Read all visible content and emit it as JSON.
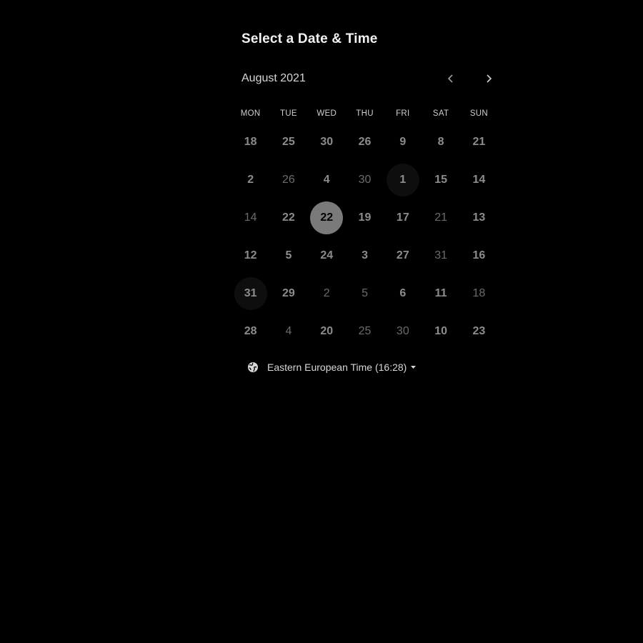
{
  "title": "Select a Date & Time",
  "month_label": "August 2021",
  "weekdays": [
    "MON",
    "TUE",
    "WED",
    "THU",
    "FRI",
    "SAT",
    "SUN"
  ],
  "days": [
    {
      "label": "18",
      "state": "available"
    },
    {
      "label": "25",
      "state": "available"
    },
    {
      "label": "30",
      "state": "available"
    },
    {
      "label": "26",
      "state": "available"
    },
    {
      "label": "9",
      "state": "available"
    },
    {
      "label": "8",
      "state": "available"
    },
    {
      "label": "21",
      "state": "available"
    },
    {
      "label": "2",
      "state": "available"
    },
    {
      "label": "26",
      "state": "unavailable"
    },
    {
      "label": "4",
      "state": "available"
    },
    {
      "label": "30",
      "state": "unavailable"
    },
    {
      "label": "1",
      "state": "available",
      "hint": true
    },
    {
      "label": "15",
      "state": "available"
    },
    {
      "label": "14",
      "state": "available"
    },
    {
      "label": "14",
      "state": "unavailable"
    },
    {
      "label": "22",
      "state": "available"
    },
    {
      "label": "22",
      "state": "selected"
    },
    {
      "label": "19",
      "state": "available"
    },
    {
      "label": "17",
      "state": "available"
    },
    {
      "label": "21",
      "state": "unavailable"
    },
    {
      "label": "13",
      "state": "available"
    },
    {
      "label": "12",
      "state": "available"
    },
    {
      "label": "5",
      "state": "available"
    },
    {
      "label": "24",
      "state": "available"
    },
    {
      "label": "3",
      "state": "available"
    },
    {
      "label": "27",
      "state": "available"
    },
    {
      "label": "31",
      "state": "unavailable"
    },
    {
      "label": "16",
      "state": "available"
    },
    {
      "label": "31",
      "state": "available",
      "hint": true
    },
    {
      "label": "29",
      "state": "available"
    },
    {
      "label": "2",
      "state": "unavailable"
    },
    {
      "label": "5",
      "state": "unavailable"
    },
    {
      "label": "6",
      "state": "available"
    },
    {
      "label": "11",
      "state": "available"
    },
    {
      "label": "18",
      "state": "unavailable"
    },
    {
      "label": "28",
      "state": "available"
    },
    {
      "label": "4",
      "state": "unavailable"
    },
    {
      "label": "20",
      "state": "available"
    },
    {
      "label": "25",
      "state": "unavailable"
    },
    {
      "label": "30",
      "state": "unavailable"
    },
    {
      "label": "10",
      "state": "available"
    },
    {
      "label": "23",
      "state": "available"
    }
  ],
  "timezone_label": "Eastern European Time (16:28)",
  "icons": {
    "prev": "chevron-left-icon",
    "next": "chevron-right-icon",
    "timezone": "globe-icon",
    "dropdown": "caret-down-icon"
  },
  "colors": {
    "background": "#000000",
    "available_text": "#8c8c8c",
    "unavailable_text": "#6b6b6b",
    "selected_bg": "#7a7a7a"
  }
}
